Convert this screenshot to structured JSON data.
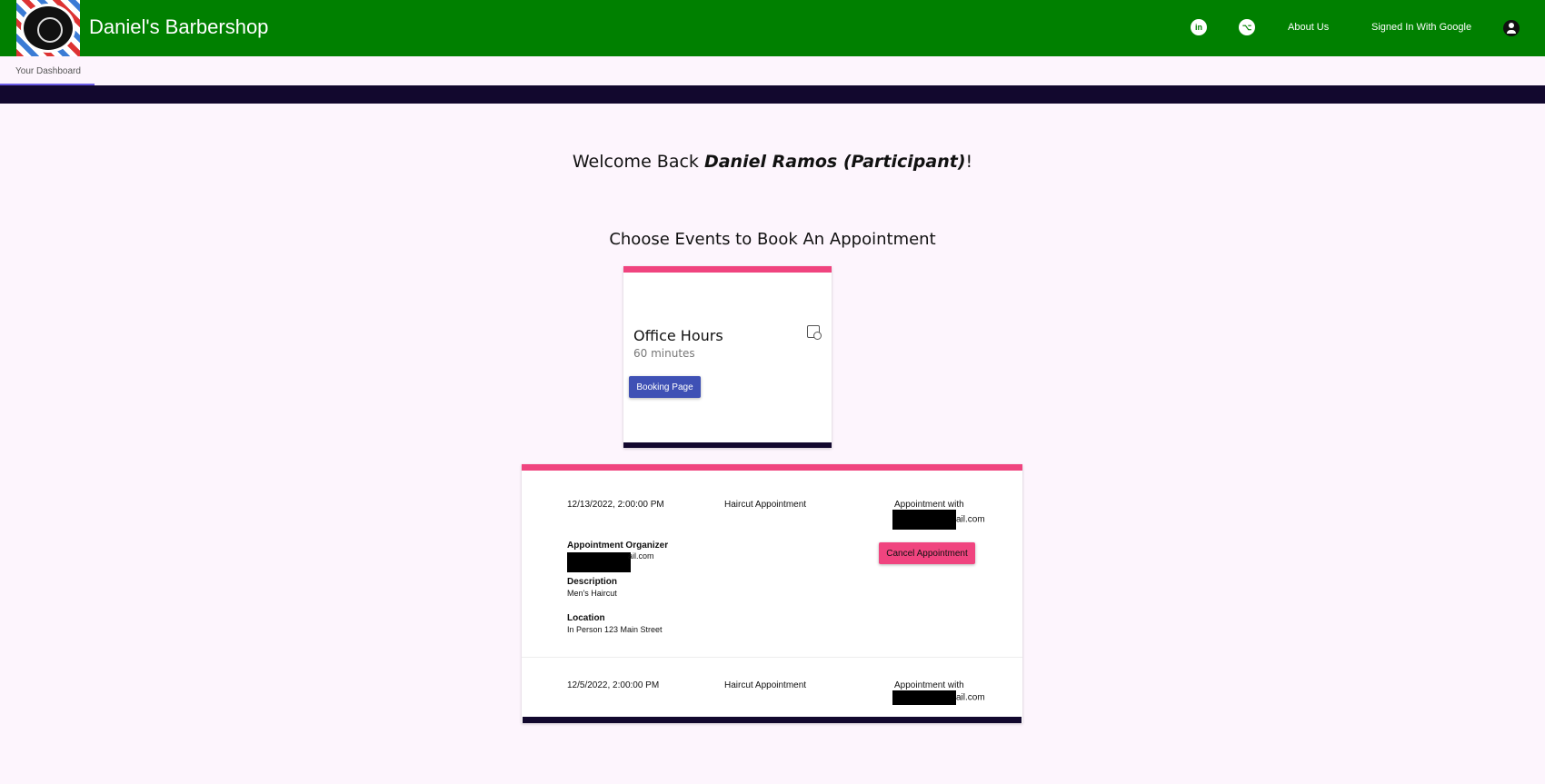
{
  "header": {
    "brand": "Daniel's Barbershop",
    "linkedin_icon": "linkedin-icon",
    "github_icon": "github-icon",
    "about_label": "About Us",
    "signin_label": "Signed In With Google",
    "account_icon": "account-circle-icon"
  },
  "tabs": {
    "dashboard_label": "Your Dashboard"
  },
  "welcome": {
    "prefix": "Welcome Back ",
    "name": "Daniel Ramos (Participant)",
    "suffix": "!"
  },
  "events_section": {
    "title": "Choose Events to Book An Appointment",
    "card": {
      "title": "Office Hours",
      "duration": "60 minutes",
      "icon": "calendar-clock-icon",
      "button_label": "Booking Page"
    }
  },
  "appointments": [
    {
      "datetime": "12/13/2022, 2:00:00 PM",
      "type": "Haircut Appointment",
      "with_label": "Appointment with",
      "with_email_visible": "ail.com",
      "organizer_label": "Appointment Organizer",
      "organizer_email_visible": "ail.com",
      "description_label": "Description",
      "description": "Men's Haircut",
      "location_label": "Location",
      "location": "In Person 123 Main Street",
      "cancel_label": "Cancel Appointment"
    },
    {
      "datetime": "12/5/2022, 2:00:00 PM",
      "type": "Haircut Appointment",
      "with_label": "Appointment with",
      "with_email_visible": "ail.com"
    }
  ],
  "colors": {
    "appbar": "#008000",
    "accent_pink": "#f0447f",
    "button_indigo": "#3f51b5",
    "dark_band": "#12082e",
    "background": "#fdf5fd"
  }
}
